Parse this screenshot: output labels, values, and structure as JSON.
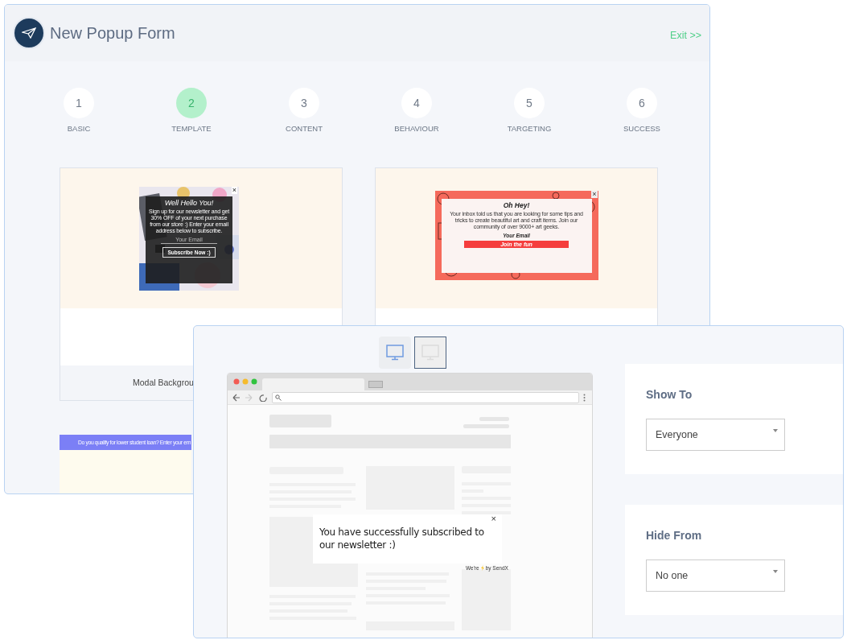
{
  "form_window": {
    "title": "New Popup Form",
    "exit_link": "Exit >>",
    "steps": [
      {
        "number": "1",
        "label": "BASIC",
        "selected": false
      },
      {
        "number": "2",
        "label": "TEMPLATE",
        "selected": true
      },
      {
        "number": "3",
        "label": "CONTENT",
        "selected": false
      },
      {
        "number": "4",
        "label": "BEHAVIOUR",
        "selected": false
      },
      {
        "number": "5",
        "label": "TARGETING",
        "selected": false
      },
      {
        "number": "6",
        "label": "SUCCESS",
        "selected": false
      }
    ],
    "templates": [
      {
        "close": "×",
        "heading": "Well Hello You!",
        "body": "Sign up for our newsletter and get 30% OFF of your next purchase from our store :) Enter your email address below to subscribe.",
        "email_placeholder": "Your Email",
        "button": "Subscribe Now :)",
        "caption": "Modal Backgrou"
      },
      {
        "kind": "pattern",
        "close": "×",
        "heading": "Oh Hey!",
        "body": "Your inbox told us that you are looking for some tips and tricks to create beautiful art and craft items. Join our community of over 9000+ art geeks.",
        "email_placeholder": "Your Email",
        "button": "Join the fun"
      },
      {
        "kind": "banner",
        "banner_text": "Do you qualify for lower student loan? Enter your em"
      }
    ]
  },
  "preview_window": {
    "device_toggles": [
      {
        "selected": true,
        "focused": false
      },
      {
        "selected": false,
        "focused": true
      }
    ],
    "success_popup": {
      "message": "You have successfully subscribed to our newsletter :)",
      "close": "×",
      "credit_before": "We're",
      "credit_after": "by SendX"
    },
    "targeting": [
      {
        "label": "Show To",
        "value": "Everyone"
      },
      {
        "label": "Hide From",
        "value": "No one"
      }
    ]
  }
}
